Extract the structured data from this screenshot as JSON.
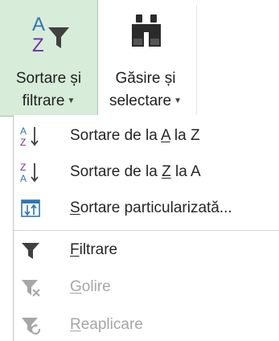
{
  "ribbon": {
    "sort_filter": {
      "label_line1": "Sortare și",
      "label_line2": "filtrare",
      "icon": "sort-filter-icon"
    },
    "find_select": {
      "label_line1": "Găsire și",
      "label_line2": "selectare",
      "icon": "binoculars-icon"
    }
  },
  "menu": {
    "items": [
      {
        "icon": "sort-az-icon",
        "pre": "Sortare de la ",
        "key": "A",
        "post": " la Z",
        "enabled": true
      },
      {
        "icon": "sort-za-icon",
        "pre": "Sortare de la ",
        "key": "Z",
        "post": " la A",
        "enabled": true
      },
      {
        "icon": "custom-sort-icon",
        "pre": "",
        "key": "S",
        "post": "ortare particularizată...",
        "enabled": true
      },
      {
        "icon": "filter-icon",
        "pre": "",
        "key": "F",
        "post": "iltrare",
        "enabled": true
      },
      {
        "icon": "clear-filter-icon",
        "pre": "",
        "key": "G",
        "post": "olire",
        "enabled": false
      },
      {
        "icon": "reapply-icon",
        "pre": "",
        "key": "R",
        "post": "eaplicare",
        "enabled": false
      }
    ]
  },
  "colors": {
    "active_button_bg": "#d7ecd9",
    "sort_a_color": "#2e75b6",
    "sort_z_color": "#7030a0",
    "disabled_text": "#a6a6a6"
  }
}
